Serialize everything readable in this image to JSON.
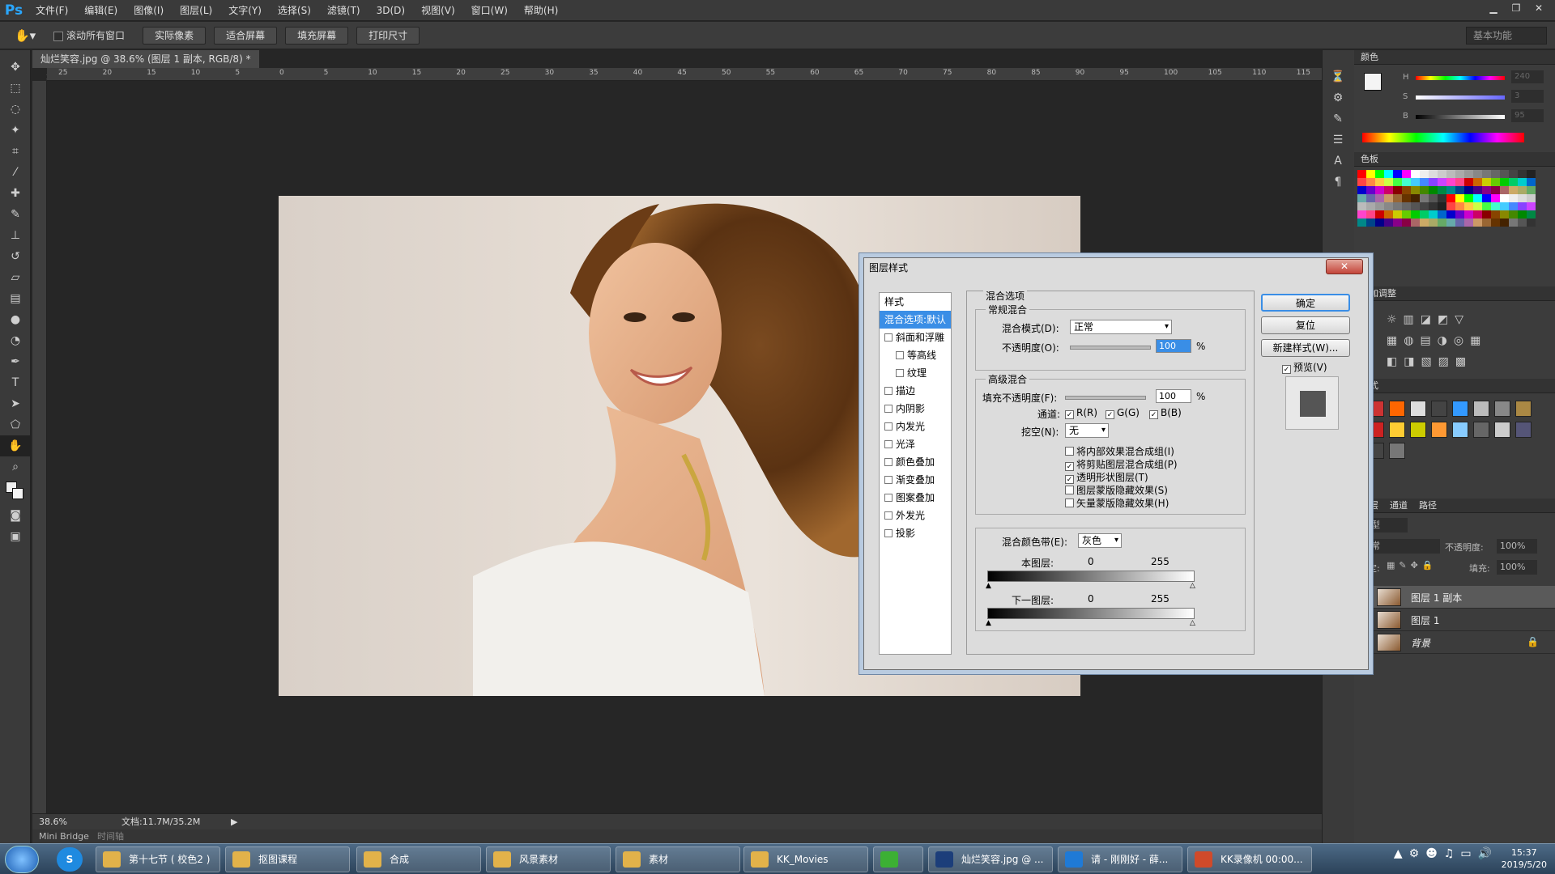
{
  "app": {
    "logo": "Ps"
  },
  "menu": [
    "文件(F)",
    "编辑(E)",
    "图像(I)",
    "图层(L)",
    "文字(Y)",
    "选择(S)",
    "滤镜(T)",
    "3D(D)",
    "视图(V)",
    "窗口(W)",
    "帮助(H)"
  ],
  "options": {
    "scroll_all_label": "滚动所有窗口",
    "buttons": [
      "实际像素",
      "适合屏幕",
      "填充屏幕",
      "打印尺寸"
    ],
    "workspace": "基本功能"
  },
  "document": {
    "tab_title": "灿烂笑容.jpg @ 38.6% (图层 1 副本, RGB/8) *",
    "ruler_top": [
      "25",
      "20",
      "15",
      "10",
      "5",
      "0",
      "5",
      "10",
      "15",
      "20",
      "25",
      "30",
      "35",
      "40",
      "45",
      "50",
      "55",
      "60",
      "65",
      "70",
      "75",
      "80",
      "85",
      "90",
      "95",
      "100",
      "105",
      "110",
      "115"
    ],
    "zoom": "38.6%",
    "doc_size": "文档:11.7M/35.2M"
  },
  "bottom_tabs": {
    "minibridge": "Mini Bridge",
    "timeline": "时间轴"
  },
  "panels": {
    "color_title": "颜色",
    "color_labels": [
      "H",
      "S",
      "B"
    ],
    "color_values": [
      "240",
      "3",
      "95"
    ],
    "swatches_title": "色板",
    "adjust_title": "添加调整",
    "styles_title": "样式",
    "layers_tabs": [
      "图层",
      "通道",
      "路径"
    ],
    "kind_label": "类型",
    "blend_mode": "正常",
    "opacity_label": "不透明度:",
    "opacity_value": "100%",
    "lock_label": "锁定:",
    "fill_label": "填充:",
    "fill_value": "100%",
    "layers": [
      "图层 1 副本",
      "图层 1",
      "背景"
    ]
  },
  "dialog": {
    "title": "图层样式",
    "close": "✕",
    "style_header": "样式",
    "style_items": [
      {
        "label": "混合选项:默认",
        "selected": true,
        "checkbox": false,
        "indent": false
      },
      {
        "label": "斜面和浮雕",
        "checkbox": true,
        "indent": false
      },
      {
        "label": "等高线",
        "checkbox": true,
        "indent": true
      },
      {
        "label": "纹理",
        "checkbox": true,
        "indent": true
      },
      {
        "label": "描边",
        "checkbox": true,
        "indent": false
      },
      {
        "label": "内阴影",
        "checkbox": true,
        "indent": false
      },
      {
        "label": "内发光",
        "checkbox": true,
        "indent": false
      },
      {
        "label": "光泽",
        "checkbox": true,
        "indent": false
      },
      {
        "label": "颜色叠加",
        "checkbox": true,
        "indent": false
      },
      {
        "label": "渐变叠加",
        "checkbox": true,
        "indent": false
      },
      {
        "label": "图案叠加",
        "checkbox": true,
        "indent": false
      },
      {
        "label": "外发光",
        "checkbox": true,
        "indent": false
      },
      {
        "label": "投影",
        "checkbox": true,
        "indent": false
      }
    ],
    "blend_options_title": "混合选项",
    "general_blend": "常规混合",
    "blend_mode_label": "混合模式(D):",
    "blend_mode_value": "正常",
    "opacity_label": "不透明度(O):",
    "opacity_value": "100",
    "percent": "%",
    "advanced_blend": "高级混合",
    "fill_opacity_label": "填充不透明度(F):",
    "fill_opacity_value": "100",
    "channels_label": "通道:",
    "channels": [
      "R(R)",
      "G(G)",
      "B(B)"
    ],
    "knockout_label": "挖空(N):",
    "knockout_value": "无",
    "adv_checks": [
      {
        "label": "将内部效果混合成组(I)",
        "checked": false
      },
      {
        "label": "将剪贴图层混合成组(P)",
        "checked": true
      },
      {
        "label": "透明形状图层(T)",
        "checked": true
      },
      {
        "label": "图层蒙版隐藏效果(S)",
        "checked": false
      },
      {
        "label": "矢量蒙版隐藏效果(H)",
        "checked": false
      }
    ],
    "blend_if_label": "混合颜色带(E):",
    "blend_if_value": "灰色",
    "this_layer_label": "本图层:",
    "this_layer_values": [
      "0",
      "255"
    ],
    "underlying_label": "下一图层:",
    "underlying_values": [
      "0",
      "255"
    ],
    "ok": "确定",
    "reset": "复位",
    "new_style": "新建样式(W)...",
    "preview": "预览(V)"
  },
  "taskbar": {
    "items": [
      "第十七节 ( 校色2 )",
      "抠图课程",
      "合成",
      "风景素材",
      "素材",
      "KK_Movies",
      "",
      "灿烂笑容.jpg @ ...",
      "请 - 刚刚好 - 薛...",
      "KK录像机 00:00..."
    ],
    "time": "15:37",
    "date": "2019/5/20"
  },
  "colors": {
    "accent": "#3a8ee6",
    "ps_blue": "#2aa7ff",
    "taskbar": "#2b4259"
  }
}
